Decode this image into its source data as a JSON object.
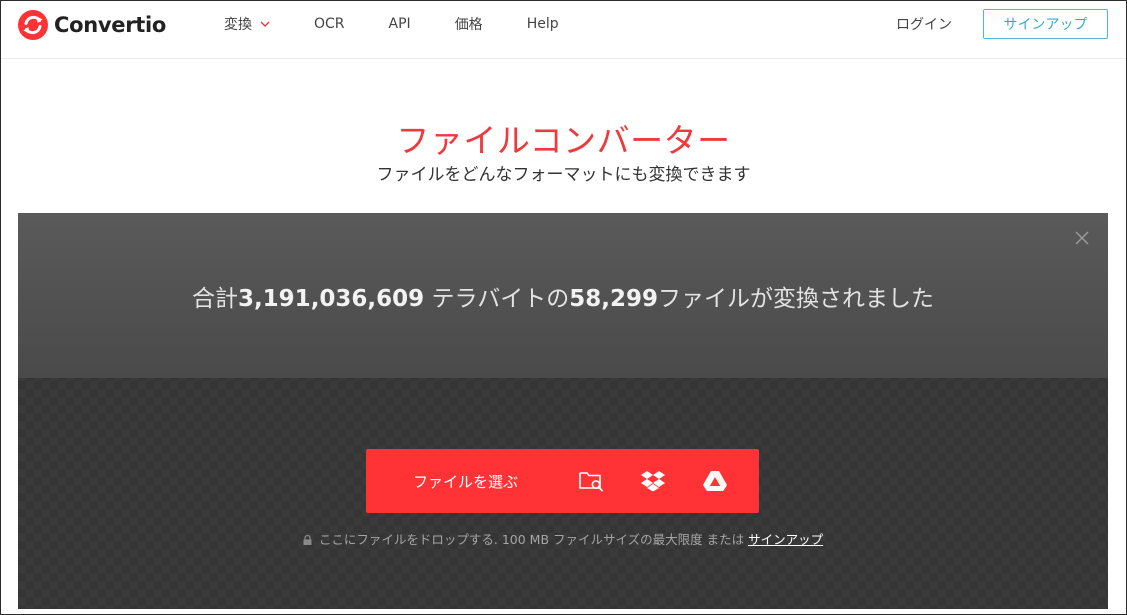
{
  "header": {
    "logo_text": "Convertio",
    "nav": [
      {
        "label": "変換",
        "has_dropdown": true
      },
      {
        "label": "OCR"
      },
      {
        "label": "API"
      },
      {
        "label": "価格"
      },
      {
        "label": "Help"
      }
    ],
    "login_label": "ログイン",
    "signup_label": "サインアップ"
  },
  "hero": {
    "title": "ファイルコンバーター",
    "subtitle": "ファイルをどんなフォーマットにも変換できます"
  },
  "panel": {
    "stats_prefix": "合計",
    "stats_bytes": "3,191,036,609",
    "stats_mid": " テラバイトの",
    "stats_files": "58,299",
    "stats_suffix": "ファイルが変換されました",
    "choose_label": "ファイルを選ぶ",
    "icons": [
      "folder-search-icon",
      "dropbox-icon",
      "google-drive-icon"
    ],
    "drop_text": "ここにファイルをドロップする. 100 MB ファイルサイズの最大限度 または ",
    "drop_link": "サインアップ"
  },
  "colors": {
    "brand_red": "#ff3336",
    "title_red": "#ee3a3c",
    "signup_blue": "#3aa9cc",
    "panel_dark": "#3a3a3a"
  }
}
